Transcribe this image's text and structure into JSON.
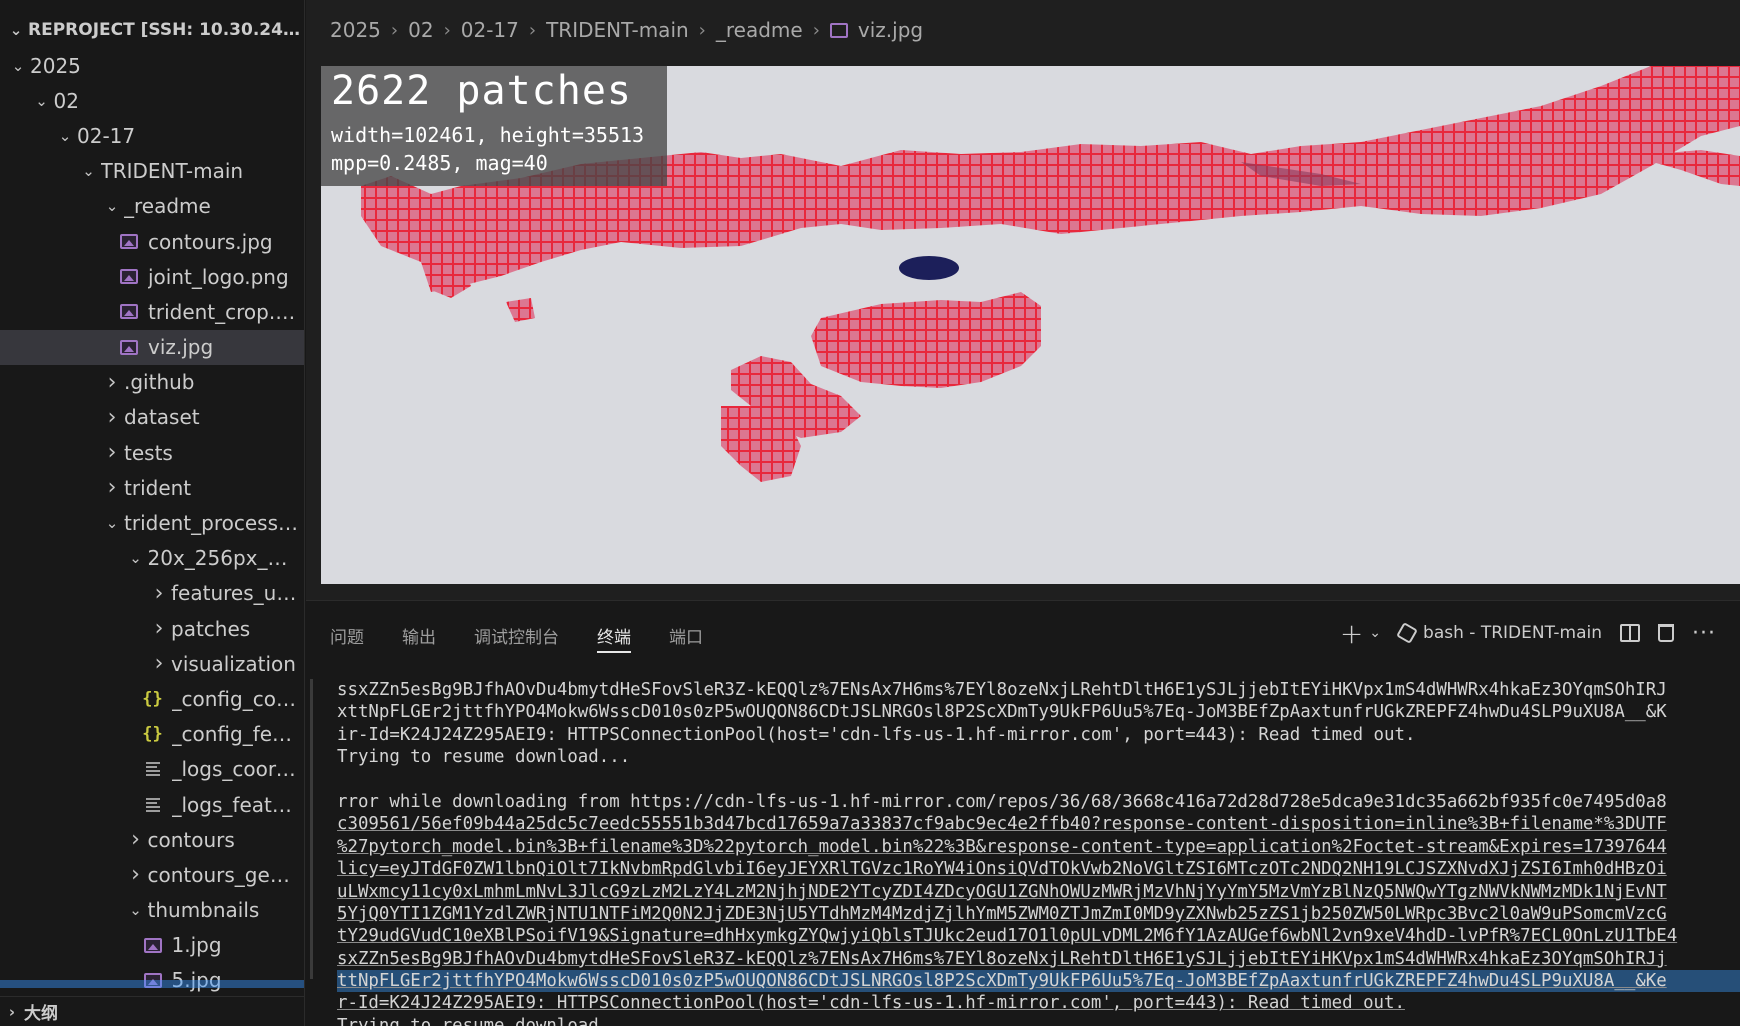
{
  "explorer": {
    "title": "REPROJECT [SSH: 10.30.24.1...",
    "tree": [
      {
        "label": "2025",
        "type": "folder",
        "open": true,
        "depth": 0
      },
      {
        "label": "02",
        "type": "folder",
        "open": true,
        "depth": 1
      },
      {
        "label": "02-17",
        "type": "folder",
        "open": true,
        "depth": 2
      },
      {
        "label": "TRIDENT-main",
        "type": "folder",
        "open": true,
        "depth": 3
      },
      {
        "label": "_readme",
        "type": "folder",
        "open": true,
        "depth": 4
      },
      {
        "label": "contours.jpg",
        "type": "image",
        "depth": 5
      },
      {
        "label": "joint_logo.png",
        "type": "image",
        "depth": 5
      },
      {
        "label": "trident_crop.jpg",
        "type": "image",
        "depth": 5
      },
      {
        "label": "viz.jpg",
        "type": "image",
        "depth": 5,
        "selected": true
      },
      {
        "label": ".github",
        "type": "folder",
        "open": false,
        "depth": 4
      },
      {
        "label": "dataset",
        "type": "folder",
        "open": false,
        "depth": 4
      },
      {
        "label": "tests",
        "type": "folder",
        "open": false,
        "depth": 4
      },
      {
        "label": "trident",
        "type": "folder",
        "open": false,
        "depth": 4
      },
      {
        "label": "trident_processed",
        "type": "folder",
        "open": true,
        "depth": 4
      },
      {
        "label": "20x_256px_0px_o...",
        "type": "folder",
        "open": true,
        "depth": 5
      },
      {
        "label": "features_uni_v1",
        "type": "folder",
        "open": false,
        "depth": 6
      },
      {
        "label": "patches",
        "type": "folder",
        "open": false,
        "depth": 6
      },
      {
        "label": "visualization",
        "type": "folder",
        "open": false,
        "depth": 6
      },
      {
        "label": "_config_coords.j...",
        "type": "json",
        "depth": 6
      },
      {
        "label": "_config_feats_un...",
        "type": "json",
        "depth": 6
      },
      {
        "label": "_logs_coords.txt",
        "type": "text",
        "depth": 6
      },
      {
        "label": "_logs_feats_uni_...",
        "type": "text",
        "depth": 6
      },
      {
        "label": "contours",
        "type": "folder",
        "open": false,
        "depth": 5
      },
      {
        "label": "contours_geojson",
        "type": "folder",
        "open": false,
        "depth": 5
      },
      {
        "label": "thumbnails",
        "type": "folder",
        "open": true,
        "depth": 5
      },
      {
        "label": "1.jpg",
        "type": "image",
        "depth": 6
      },
      {
        "label": "5.jpg",
        "type": "image",
        "depth": 6
      }
    ],
    "outline_label": "大纲"
  },
  "breadcrumb": [
    "2025",
    "02",
    "02-17",
    "TRIDENT-main",
    "_readme",
    "viz.jpg"
  ],
  "image_overlay": {
    "title": "2622 patches",
    "line1": "width=102461, height=35513",
    "line2": "mpp=0.2485, mag=40"
  },
  "panel": {
    "tabs": [
      {
        "label": "问题",
        "active": false
      },
      {
        "label": "输出",
        "active": false
      },
      {
        "label": "调试控制台",
        "active": false
      },
      {
        "label": "终端",
        "active": true
      },
      {
        "label": "端口",
        "active": false
      }
    ],
    "terminal_name": "bash - TRIDENT-main"
  },
  "terminal": {
    "lines": [
      {
        "text": "ssxZZn5esBg9BJfhAOvDu4bmytdHeSFovSleR3Z-kEQQlz%7ENsAx7H6ms%7EYl8ozeNxjLRehtDltH6E1ySJLjjebItEYiHKVpx1mS4dWHWRx4hkaEz3OYqmSOhIRJ",
        "style": "plain"
      },
      {
        "text": "xttNpFLGEr2jttfhYPO4Mokw6WsscD010s0zP5wOUQON86CDtJSLNRGOsl8P2ScXDmTy9UkFP6Uu5%7Eq-JoM3BEfZpAaxtunfrUGkZREPFZ4hwDu4SLP9uXU8A__&K",
        "style": "plain"
      },
      {
        "text": "ir-Id=K24J24Z295AEI9: HTTPSConnectionPool(host='cdn-lfs-us-1.hf-mirror.com', port=443): Read timed out.",
        "style": "plain"
      },
      {
        "text": "Trying to resume download...",
        "style": "plain"
      },
      {
        "text": "",
        "style": "plain"
      },
      {
        "text": "rror while downloading from https://cdn-lfs-us-1.hf-mirror.com/repos/36/68/3668c416a72d28d728e5dca9e31dc35a662bf935fc0e7495d0a8",
        "style": "plain"
      },
      {
        "text": "c309561/56ef09b44a25dc5c7eedc55551b3d47bcd17659a7a33837cf9abc9ec4e2ffb40?response-content-disposition=inline%3B+filename*%3DUTF",
        "style": "link"
      },
      {
        "text": "%27pytorch_model.bin%3B+filename%3D%22pytorch_model.bin%22%3B&response-content-type=application%2Foctet-stream&Expires=17397644",
        "style": "link"
      },
      {
        "text": "licy=eyJTdGF0ZW1lbnQiOlt7IkNvbmRpdGlvbiI6eyJEYXRlTGVzc1RoYW4iOnsiQVdTOkVwb2NoVGltZSI6MTczOTc2NDQ2NH19LCJSZXNvdXJjZSI6Imh0dHBzOi",
        "style": "link"
      },
      {
        "text": "uLWxmcy11cy0xLmhmLmNvL3JlcG9zLzM2LzY4LzM2NjhjNDE2YTcyZDI4ZDcyOGU1ZGNhOWUzMWRjMzVhNjYyYmY5MzVmYzBlNzQ5NWQwYTgzNWVkNWMzMDk1NjEvNT",
        "style": "link"
      },
      {
        "text": "5YjQ0YTI1ZGM1YzdlZWRjNTU1NTFiM2Q0N2JjZDE3NjU5YTdhMzM4MzdjZjlhYmM5ZWM0ZTJmZmI0MD9yZXNwb25zZS1jb250ZW50LWRpc3Bvc2l0aW9uPSomcmVzcG",
        "style": "link"
      },
      {
        "text": "tY29udGVudC10eXBlPSoifV19&Signature=dhHxymkgZYQwjyiQblsTJUkc2eud17O1l0pULvDML2M6fY1AzAUGef6wbNl2vn9xeV4hdD-lvPfR%7ECL0OnLzU1TbE4",
        "style": "link"
      },
      {
        "text": "sxZZn5esBg9BJfhAOvDu4bmytdHeSFovSleR3Z-kEQQlz%7ENsAx7H6ms%7EYl8ozeNxjLRehtDltH6E1ySJLjjebItEYiHKVpx1mS4dWHWRx4hkaEz3OYqmSOhIRJj",
        "style": "link"
      },
      {
        "text": "ttNpFLGEr2jttfhYPO4Mokw6WsscD010s0zP5wOUQON86CDtJSLNRGOsl8P2ScXDmTy9UkFP6Uu5%7Eq-JoM3BEfZpAaxtunfrUGkZREPFZ4hwDu4SLP9uXU8A__&Ke",
        "style": "link-hl"
      },
      {
        "text": "r-Id=K24J24Z295AEI9: HTTPSConnectionPool(host='cdn-lfs-us-1.hf-mirror.com', port=443): Read timed out.",
        "style": "link-end"
      },
      {
        "text": "Trying to resume download...",
        "style": "plain"
      }
    ]
  },
  "colors": {
    "tissue": "#d9708e",
    "patch_grid": "#e8283c",
    "slide_bg": "#d9dadf",
    "dark_blob": "#1c1f5a",
    "accent": "#a074c4"
  }
}
